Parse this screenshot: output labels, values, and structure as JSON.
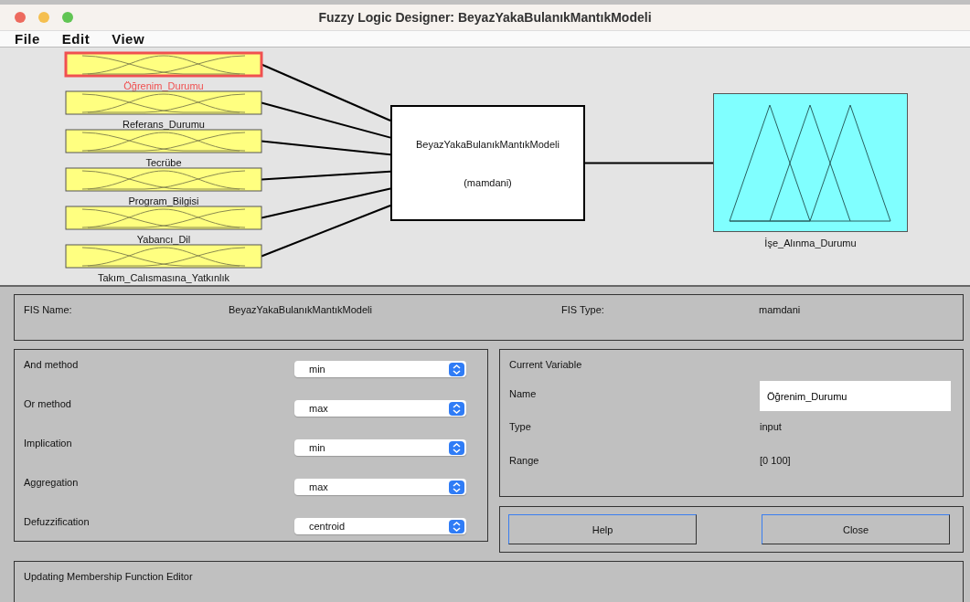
{
  "window": {
    "title": "Fuzzy Logic Designer: BeyazYakaBulanıkMantıkModeli"
  },
  "menu": [
    "File",
    "Edit",
    "View"
  ],
  "diagram": {
    "inputs": [
      {
        "name": "Öğrenim_Durumu",
        "selected": true
      },
      {
        "name": "Referans_Durumu",
        "selected": false
      },
      {
        "name": "Tecrübe",
        "selected": false
      },
      {
        "name": "Program_Bilgisi",
        "selected": false
      },
      {
        "name": "Yabancı_Dil",
        "selected": false
      },
      {
        "name": "Takım_Calısmasına_Yatkınlık",
        "selected": false
      }
    ],
    "system": {
      "name": "BeyazYakaBulanıkMantıkModeli",
      "type": "(mamdani)"
    },
    "output": {
      "name": "İşe_Alınma_Durumu"
    }
  },
  "fis_info": {
    "name_label": "FIS Name:",
    "name": "BeyazYakaBulanıkMantıkModeli",
    "type_label": "FIS Type:",
    "type": "mamdani"
  },
  "methods": [
    {
      "label": "And method",
      "value": "min"
    },
    {
      "label": "Or method",
      "value": "max"
    },
    {
      "label": "Implication",
      "value": "min"
    },
    {
      "label": "Aggregation",
      "value": "max"
    },
    {
      "label": "Defuzzification",
      "value": "centroid"
    }
  ],
  "current_variable": {
    "title": "Current Variable",
    "name_label": "Name",
    "name": "Öğrenim_Durumu",
    "type_label": "Type",
    "type": "input",
    "range_label": "Range",
    "range": "[0 100]"
  },
  "buttons": [
    "Help",
    "Close"
  ],
  "status": "Updating Membership Function Editor"
}
